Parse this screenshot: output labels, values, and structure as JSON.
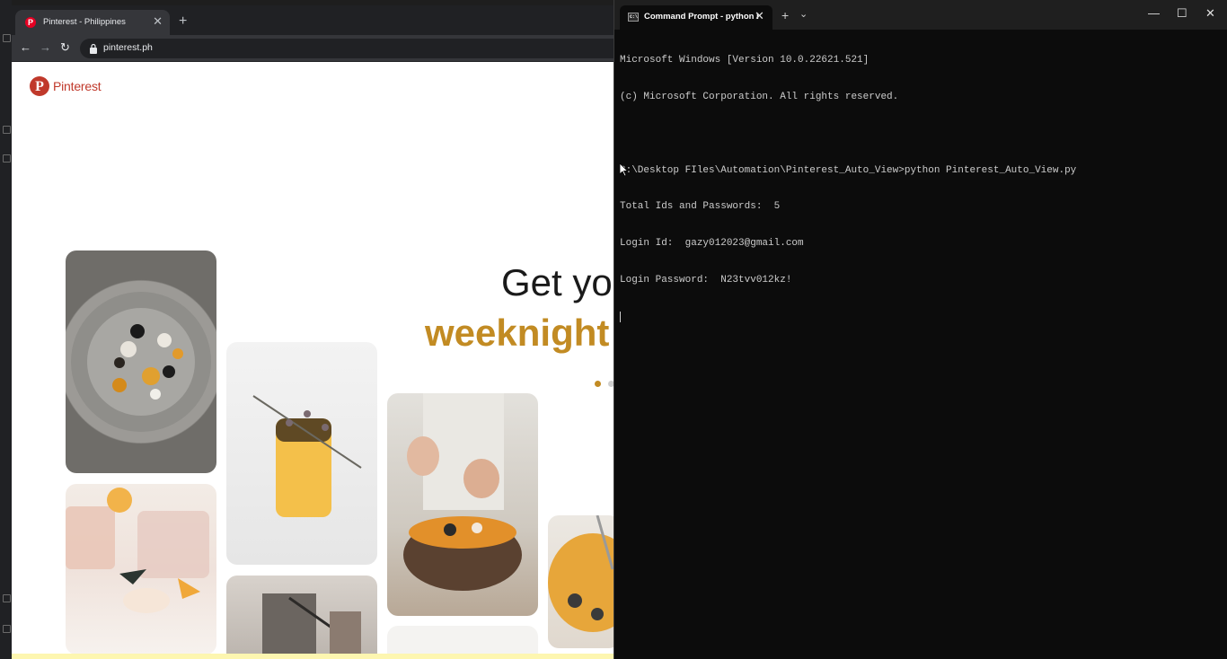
{
  "browser": {
    "tab_title": "Pinterest - Philippines",
    "tab_close": "✕",
    "new_tab": "+",
    "url": "pinterest.ph",
    "back": "←",
    "forward": "→",
    "reload": "↻"
  },
  "pinterest": {
    "logo_letter": "P",
    "brand": "Pinterest",
    "headline_line1": "Get yo",
    "headline_line2": "weeknight",
    "accent_color": "#c28b23",
    "brand_color": "#c0392b",
    "tiles": [
      "plate-salad-photo",
      "orange-drink-photo",
      "hands-cooking-photo",
      "pink-cocktail-photo",
      "grater-photo",
      "pumpkin-toast-photo"
    ]
  },
  "terminal": {
    "tab_title": "Command Prompt - python I",
    "tab_close": "✕",
    "new_tab": "+",
    "dropdown": "⌄",
    "minimize": "—",
    "maximize": "☐",
    "close": "✕",
    "lines": [
      "Microsoft Windows [Version 10.0.22621.521]",
      "(c) Microsoft Corporation. All rights reserved.",
      "",
      "D:\\Desktop FIles\\Automation\\Pinterest_Auto_View>python Pinterest_Auto_View.py",
      "Total Ids and Passwords:  5",
      "Login Id:  gazy012023@gmail.com",
      "Login Password:  N23tvv012kz!"
    ]
  }
}
